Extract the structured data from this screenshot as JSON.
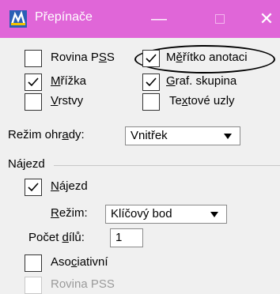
{
  "window": {
    "title": "Přepínače",
    "minimize_glyph": "—",
    "close_glyph": "✕",
    "accent": "#e066d8",
    "icon": "app-icon"
  },
  "checkboxes": {
    "rovina_pss": {
      "pre": "Rovina P",
      "u": "S",
      "post": "S",
      "checked": false
    },
    "meritko_anotaci": {
      "pre": "M",
      "u": "ě",
      "post": "řítko anotaci",
      "checked": true
    },
    "mrizka": {
      "pre": "",
      "u": "M",
      "post": "řížka",
      "checked": true
    },
    "graf_skupina": {
      "pre": "",
      "u": "G",
      "post": "raf. skupina",
      "checked": true
    },
    "vrstvy": {
      "pre": "",
      "u": "V",
      "post": "rstvy",
      "checked": false
    },
    "textove_uzly": {
      "pre": "Te",
      "u": "x",
      "post": "tové uzly",
      "checked": false
    }
  },
  "fence_mode": {
    "label_pre": "Režim ohr",
    "label_u": "a",
    "label_post": "dy:",
    "value": "Vnitřek"
  },
  "snap_group": {
    "title": "Nájezd"
  },
  "snap": {
    "pre": "",
    "u": "N",
    "post": "ájezd",
    "checked": true
  },
  "snap_mode": {
    "label_pre": "",
    "label_u": "R",
    "label_post": "ežim:",
    "value": "Klíčový bod"
  },
  "divisions": {
    "label_pre": "Počet ",
    "label_u": "d",
    "label_post": "ílů:",
    "value": "1"
  },
  "associative": {
    "pre": "Aso",
    "u": "c",
    "post": "iativní",
    "checked": false
  },
  "rovina_pss_disabled": {
    "label": "Rovina PSS",
    "checked": false
  }
}
